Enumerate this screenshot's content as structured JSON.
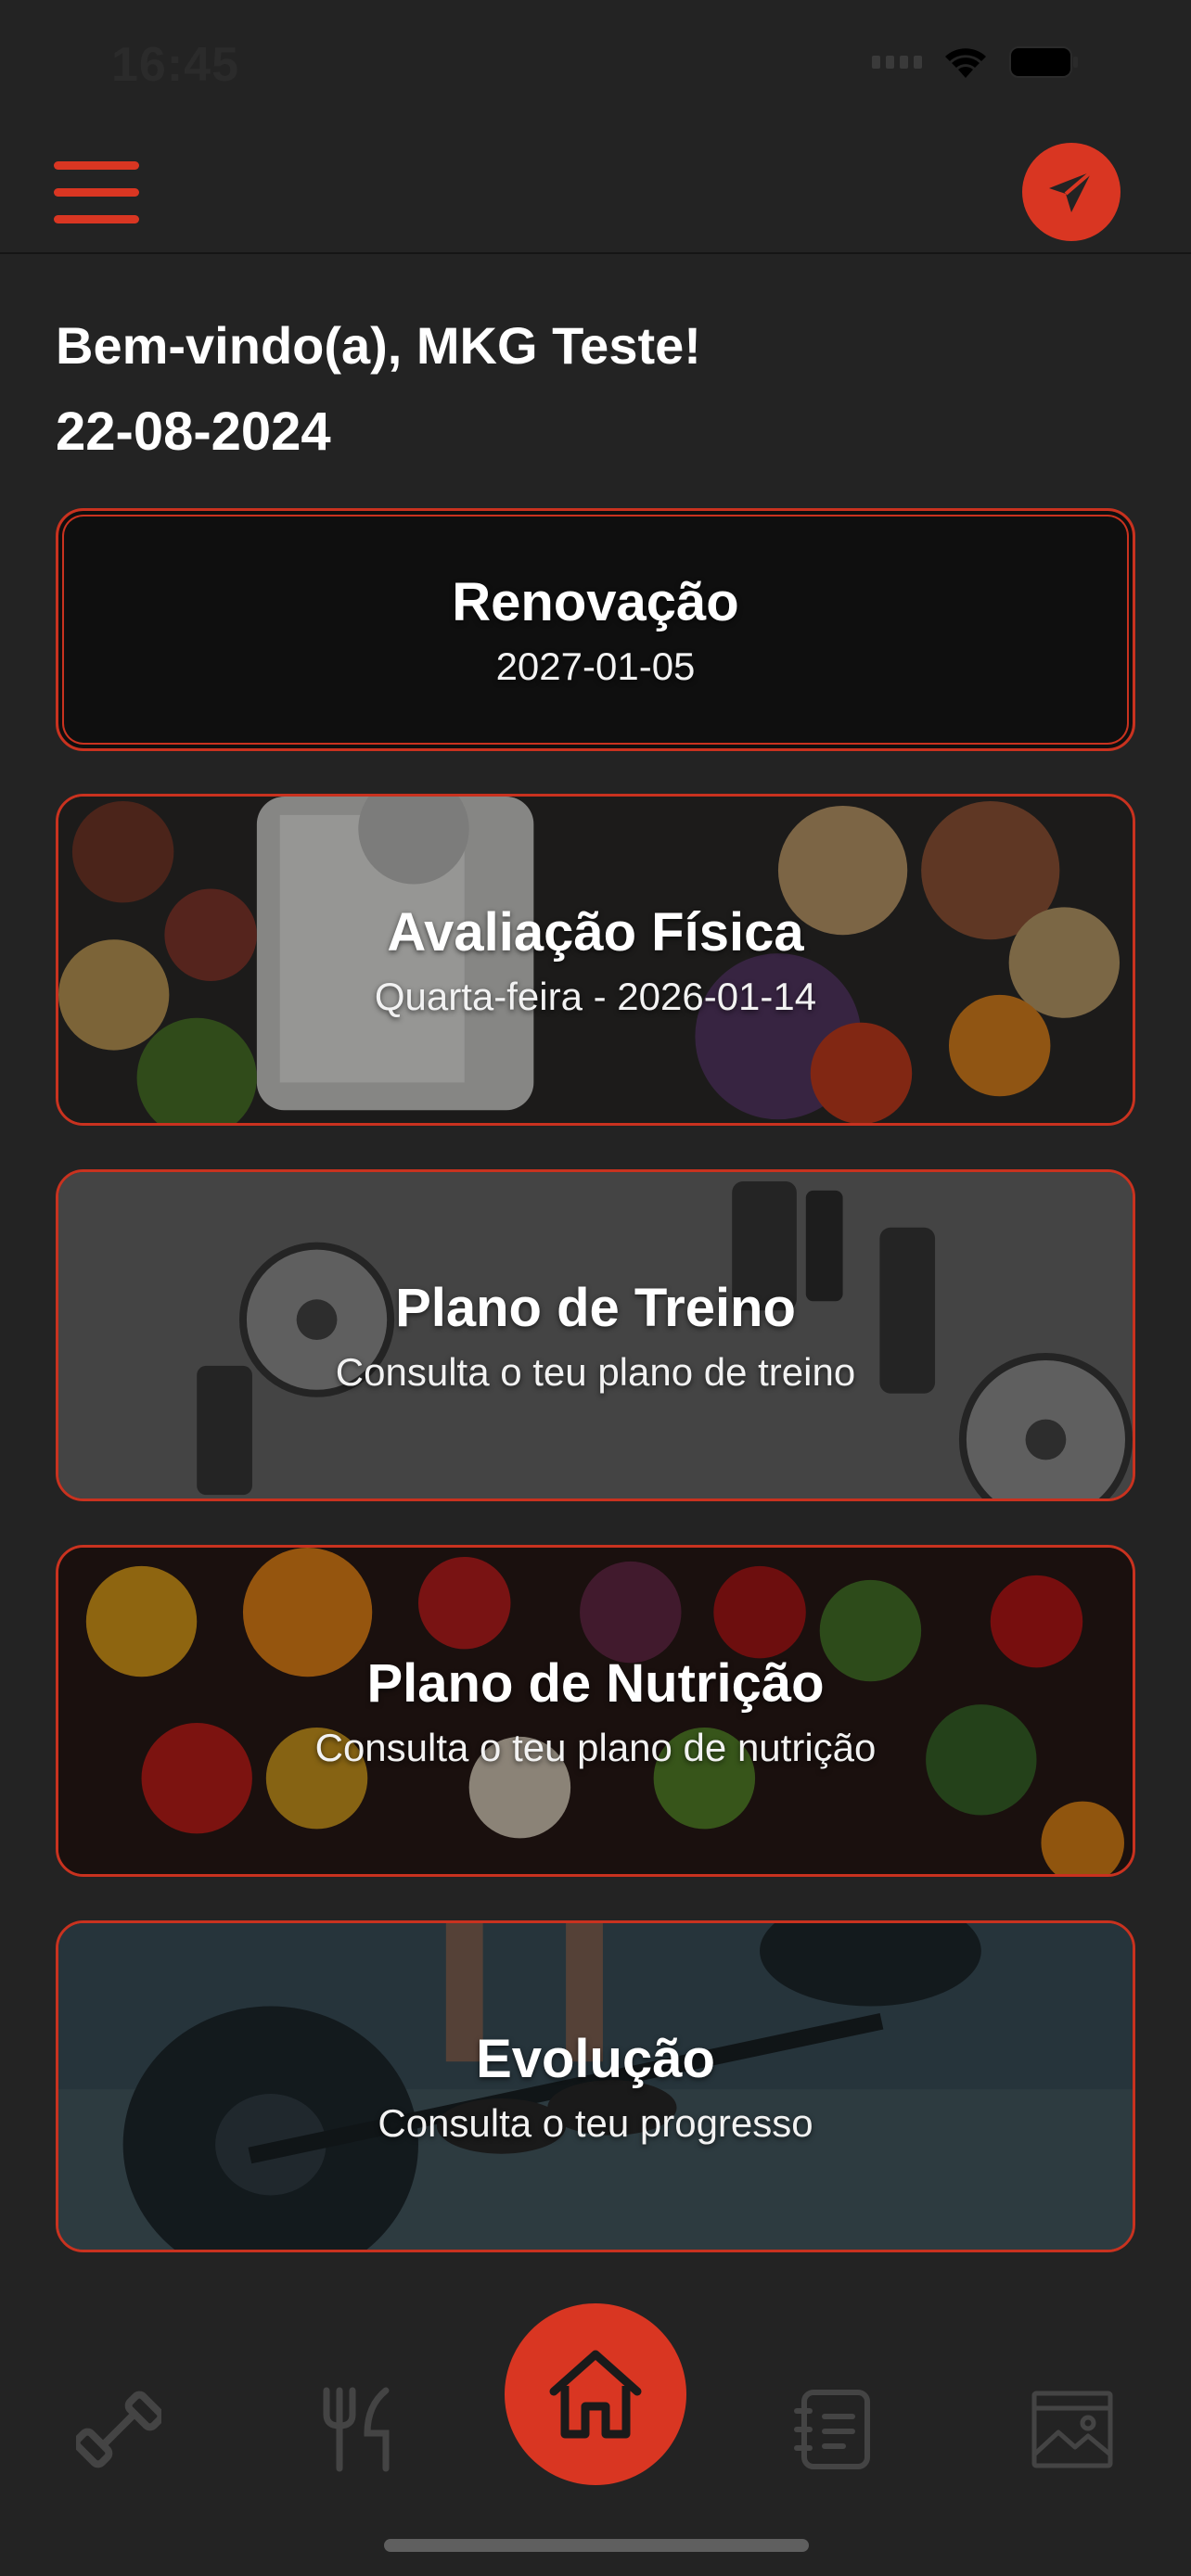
{
  "status_bar": {
    "time": "16:45"
  },
  "header": {
    "menu_icon": "hamburger-menu-icon",
    "send_icon": "paper-plane-icon"
  },
  "greeting": {
    "welcome": "Bem-vindo(a), MKG Teste!",
    "date": "22-08-2024"
  },
  "cards": [
    {
      "title": "Renovação",
      "subtitle": "2027-01-05"
    },
    {
      "title": "Avaliação Física",
      "subtitle": "Quarta-feira - 2026-01-14"
    },
    {
      "title": "Plano de Treino",
      "subtitle": "Consulta o teu plano de treino"
    },
    {
      "title": "Plano de Nutrição",
      "subtitle": "Consulta o teu plano de nutrição"
    },
    {
      "title": "Evolução",
      "subtitle": "Consulta o teu progresso"
    }
  ],
  "tab_bar": {
    "items": [
      "dumbbell-icon",
      "fork-knife-icon",
      "home-icon",
      "notebook-icon",
      "gallery-icon"
    ],
    "active": "home-icon"
  },
  "colors": {
    "accent": "#d93622",
    "background": "#232323",
    "card_border": "#c9321f",
    "inactive_icon": "#444444"
  }
}
